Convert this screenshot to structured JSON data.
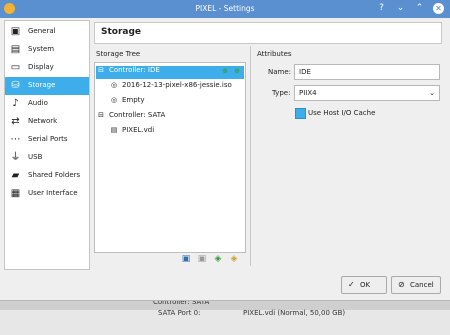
{
  "window": {
    "title": "PIXEL - Settings"
  },
  "sidebar": {
    "items": [
      {
        "label": "General",
        "icon": "general-icon"
      },
      {
        "label": "System",
        "icon": "system-icon"
      },
      {
        "label": "Display",
        "icon": "display-icon"
      },
      {
        "label": "Storage",
        "icon": "storage-icon",
        "selected": true
      },
      {
        "label": "Audio",
        "icon": "audio-icon"
      },
      {
        "label": "Network",
        "icon": "network-icon"
      },
      {
        "label": "Serial Ports",
        "icon": "serial-ports-icon"
      },
      {
        "label": "USB",
        "icon": "usb-icon"
      },
      {
        "label": "Shared Folders",
        "icon": "shared-folders-icon"
      },
      {
        "label": "User Interface",
        "icon": "user-interface-icon"
      }
    ]
  },
  "page": {
    "title": "Storage"
  },
  "storage_tree": {
    "label": "Storage Tree",
    "controller_ide": "Controller: IDE",
    "ide_disc_1": "2016-12-13-pixel-x86-jessie.iso",
    "ide_disc_2": "Empty",
    "controller_sata": "Controller: SATA",
    "sata_disk": "PIXEL.vdi"
  },
  "attributes": {
    "label": "Attributes",
    "name_label": "Name:",
    "name_value": "IDE",
    "type_label": "Type:",
    "type_value": "PIIX4",
    "host_io_cache_label": "Use Host I/O Cache",
    "host_io_cache_checked": true
  },
  "buttons": {
    "ok": "OK",
    "cancel": "Cancel"
  },
  "background_window": {
    "controller": "Controller: SATA",
    "port_label": "SATA Port 0:",
    "port_value": "PIXEL.vdi (Normal, 50,00 GB)"
  },
  "colors": {
    "accent": "#3daee9",
    "titlebar": "#5a8fd0"
  }
}
